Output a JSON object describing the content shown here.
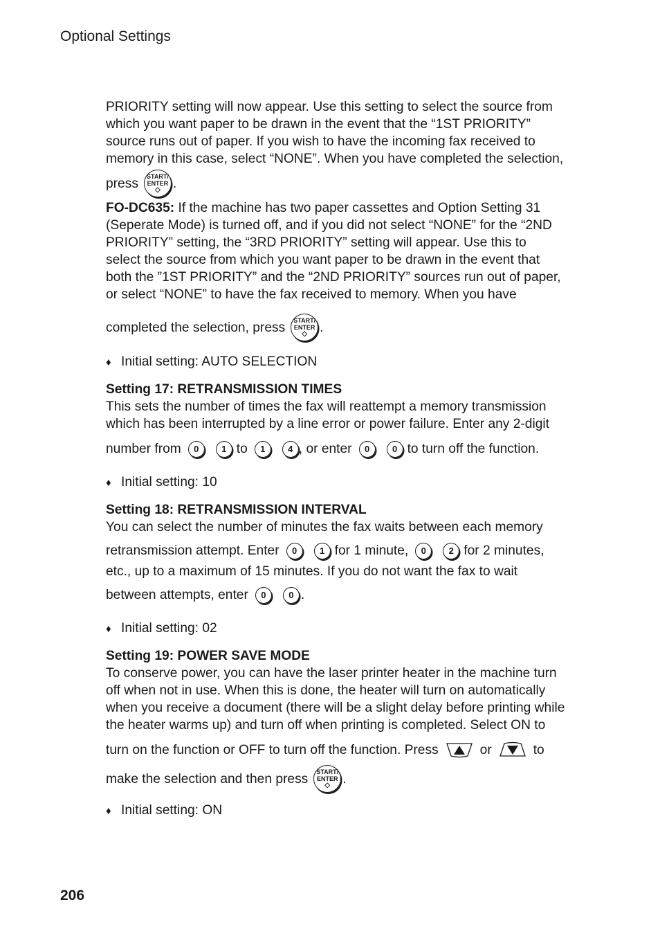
{
  "header": {
    "section_title": "Optional Settings"
  },
  "page_number": "206",
  "keys": {
    "start_line1": "START/",
    "start_line2": "ENTER",
    "start_symbol": "◇"
  },
  "priority_block": {
    "para1": [
      "PRIORITY setting will now appear. Use this setting to select the source from",
      "which you want paper to be drawn in the event that the “1ST PRIORITY”",
      "source runs out of paper. If you wish to have the incoming fax received to",
      "memory in this case, select “NONE”. When you have completed the selection,"
    ],
    "press_label": "press",
    "period": ".",
    "model_label": "FO-DC635:",
    "para2_first": " If the machine has two paper cassettes and Option Setting 31",
    "para2": [
      "(Seperate Mode) is turned off, and if you did not select “NONE” for the “2ND",
      "PRIORITY” setting, the “3RD PRIORITY” setting will appear. Use this to",
      "select the source from which you want paper to be drawn in the event that",
      "both the ”1ST PRIORITY” and the “2ND PRIORITY” sources run out of paper,",
      "or select “NONE” to have the fax received to memory. When you have"
    ],
    "completed_label": "completed the selection, press",
    "initial": "Initial setting: AUTO SELECTION"
  },
  "setting17": {
    "heading": "Setting 17: RETRANSMISSION TIMES",
    "lines": [
      "This sets the number of times the fax will reattempt a memory transmission",
      "which has been interrupted by a line error or power failure. Enter any 2-digit"
    ],
    "number_from": "number from",
    "to": "to",
    "or_enter": ", or enter",
    "turn_off": "to turn off the function.",
    "keys": [
      "0",
      "1",
      "1",
      "4",
      "0",
      "0"
    ],
    "initial": "Initial setting: 10"
  },
  "setting18": {
    "heading": "Setting 18: RETRANSMISSION INTERVAL",
    "line1": "You can select the number of minutes the fax waits between each memory",
    "retrans_label": "retransmission attempt. Enter",
    "for1": "for 1 minute,",
    "for2": "for 2 minutes,",
    "line3": "etc., up to a maximum of 15 minutes. If you do not want the fax to wait",
    "between_label": "between attempts, enter",
    "keys": [
      "0",
      "1",
      "0",
      "2",
      "0",
      "0"
    ],
    "initial": "Initial setting: 02"
  },
  "setting19": {
    "heading": "Setting 19: POWER SAVE MODE",
    "lines": [
      "To conserve power, you can have the laser printer heater in the machine turn",
      "off when not in use. When this is done, the heater will turn on automatically",
      "when you receive a document (there will be a slight delay before printing while",
      "the heater warms up) and turn off when printing is completed. Select ON to"
    ],
    "turn_on_label": "turn on the function or OFF to turn off the function. Press",
    "or": "or",
    "to": "to",
    "make_label": "make the selection and then press",
    "initial": "Initial setting: ON"
  },
  "bullet_symbol": "♦"
}
